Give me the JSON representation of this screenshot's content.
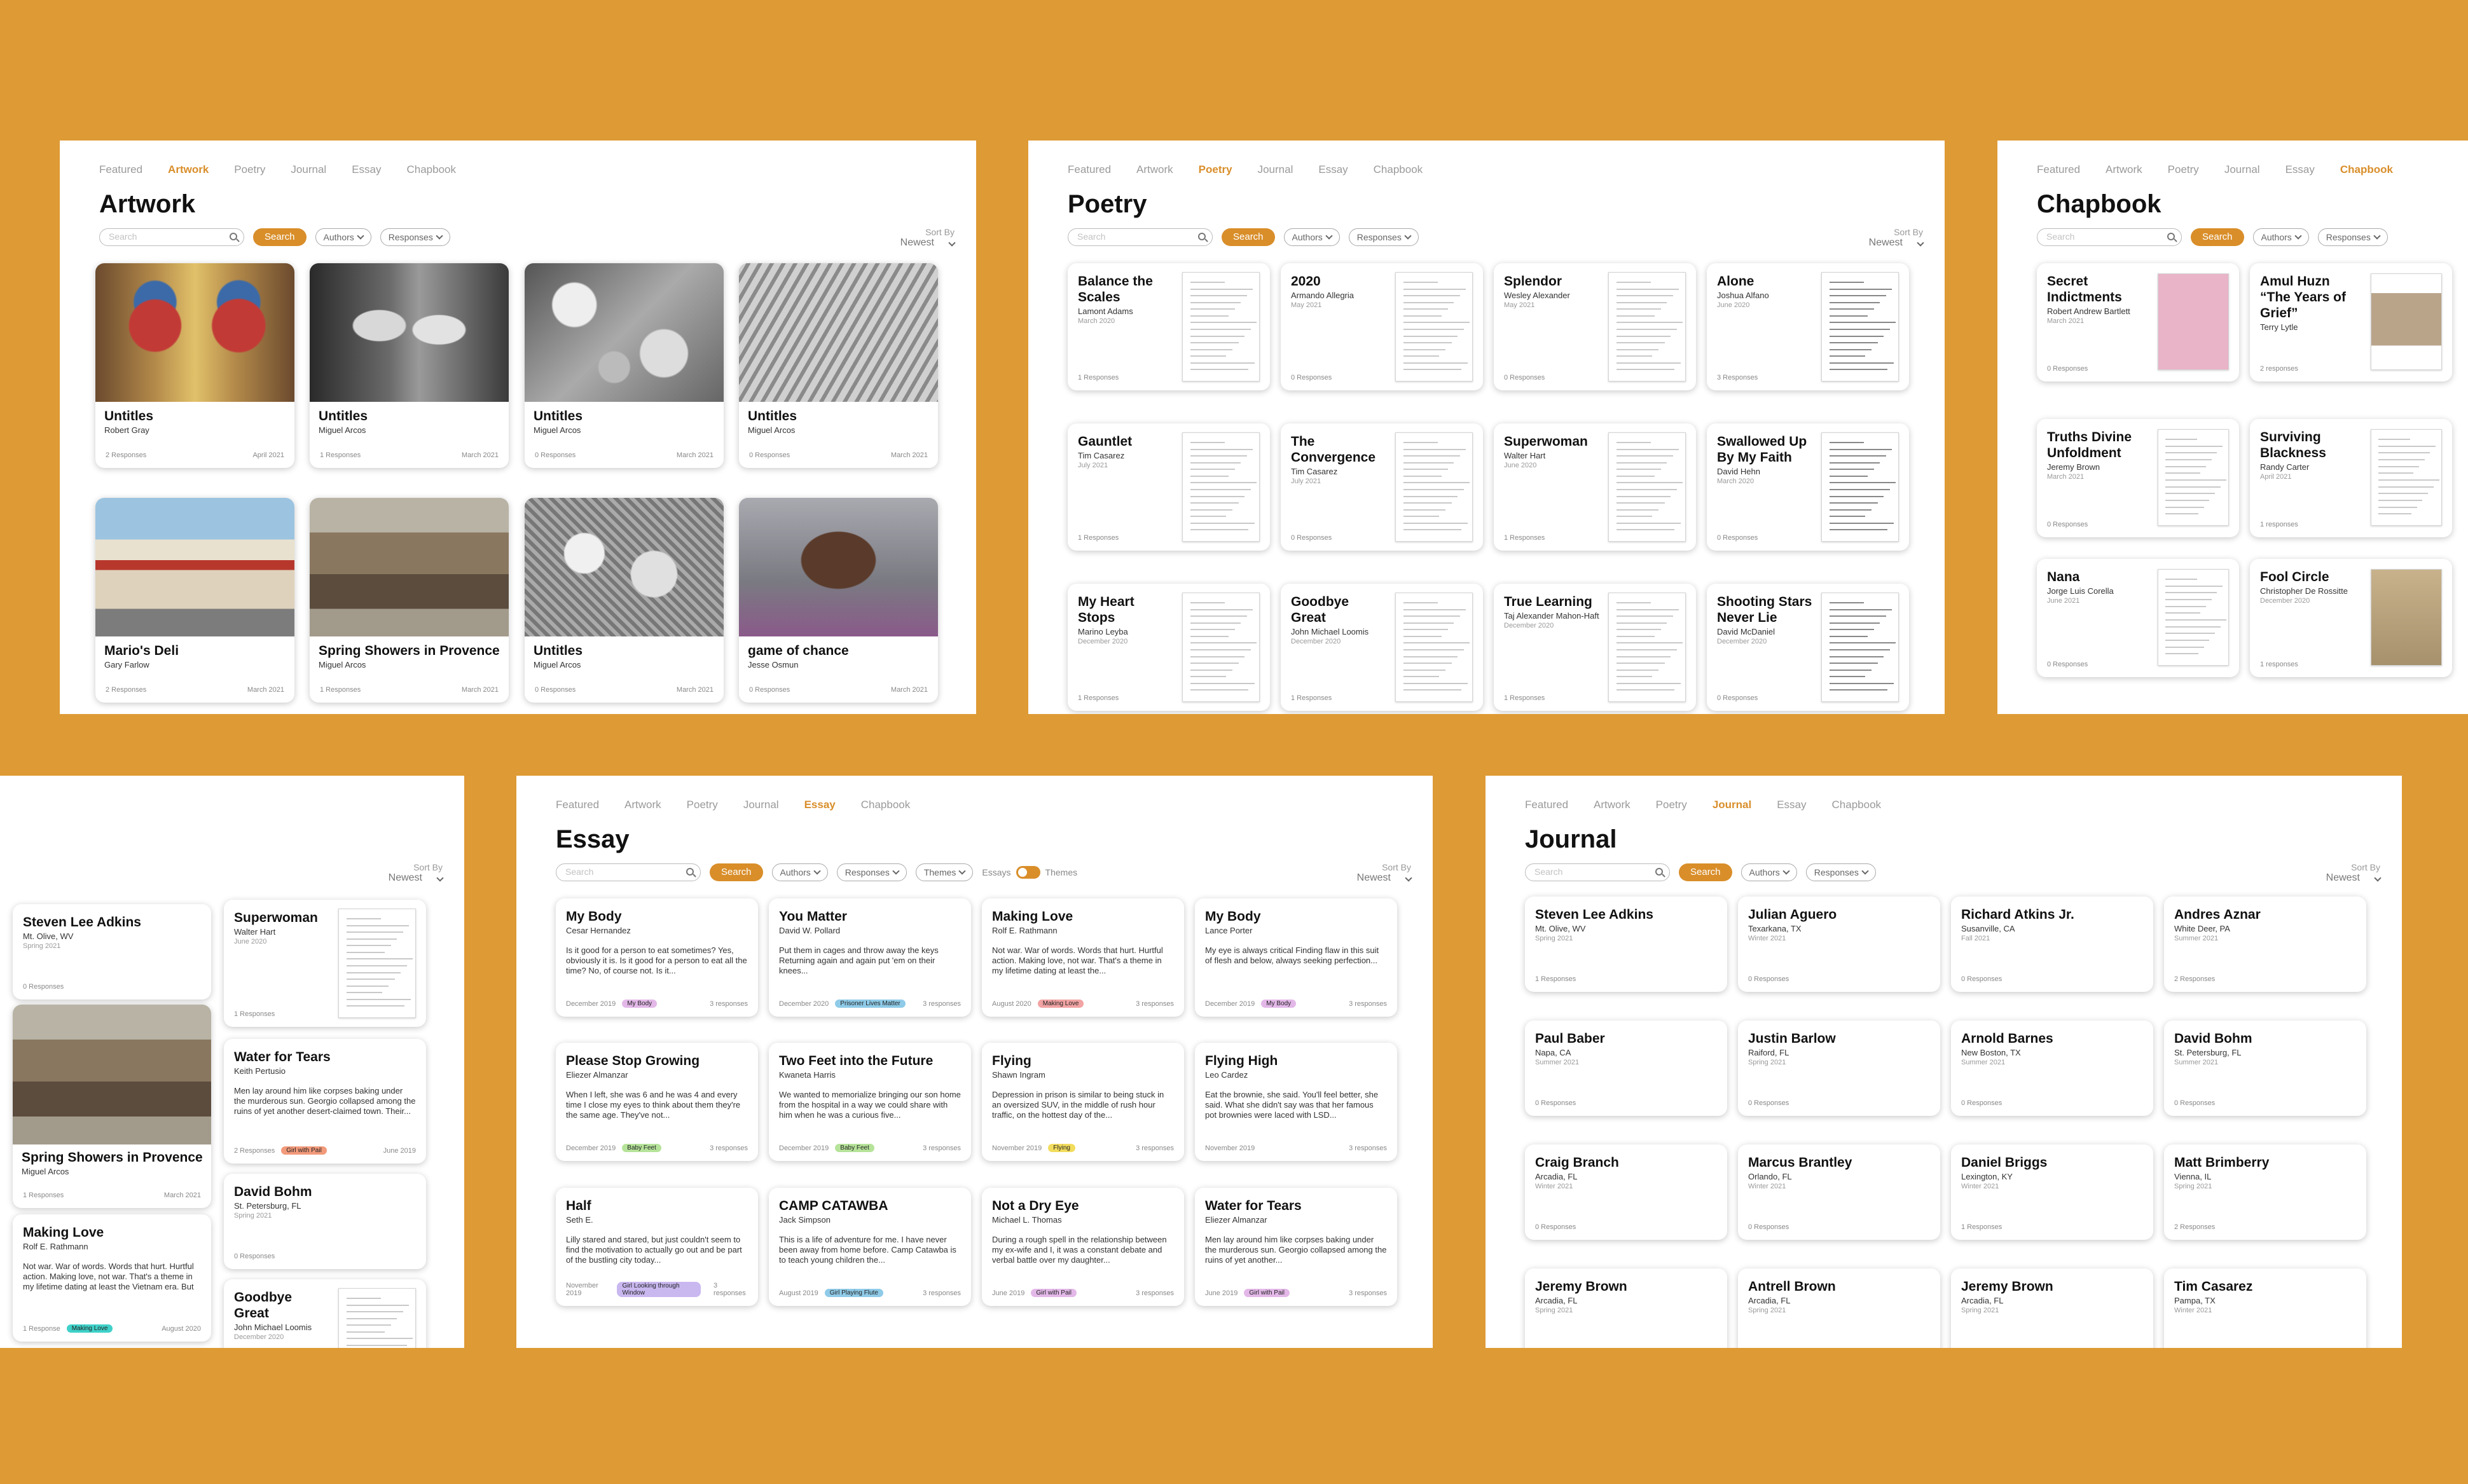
{
  "nav": [
    "Featured",
    "Artwork",
    "Poetry",
    "Journal",
    "Essay",
    "Chapbook"
  ],
  "ui": {
    "search_placeholder": "Search",
    "search_btn": "Search",
    "authors": "Authors",
    "responses": "Responses",
    "themes": "Themes",
    "sort_label": "Sort By",
    "sort_value": "Newest",
    "toggle_left": "Essays",
    "toggle_right": "Themes"
  },
  "artwork": {
    "title": "Artwork",
    "cards": [
      {
        "title": "Untitles",
        "author": "Robert Gray",
        "responses": "2 Responses",
        "date": "April 2021",
        "img": "baboons"
      },
      {
        "title": "Untitles",
        "author": "Miguel Arcos",
        "responses": "1 Responses",
        "date": "March 2021",
        "img": "portrait"
      },
      {
        "title": "Untitles",
        "author": "Miguel Arcos",
        "responses": "0 Responses",
        "date": "March 2021",
        "img": "faces"
      },
      {
        "title": "Untitles",
        "author": "Miguel Arcos",
        "responses": "0 Responses",
        "date": "March 2021",
        "img": "tiger"
      },
      {
        "title": "Mario's Deli",
        "author": "Gary Farlow",
        "responses": "2 Responses",
        "date": "March 2021",
        "img": "deli"
      },
      {
        "title": "Spring Showers in Provence",
        "author": "Miguel Arcos",
        "responses": "1 Responses",
        "date": "March 2021",
        "img": "street"
      },
      {
        "title": "Untitles",
        "author": "Miguel Arcos",
        "responses": "0 Responses",
        "date": "March 2021",
        "img": "animals"
      },
      {
        "title": "game of chance",
        "author": "Jesse Osmun",
        "responses": "0 Responses",
        "date": "March 2021",
        "img": "gamer"
      }
    ]
  },
  "poetry": {
    "title": "Poetry",
    "cards": [
      {
        "title": "Balance the Scales",
        "author": "Lamont Adams",
        "date": "March 2020",
        "responses": "1 Responses"
      },
      {
        "title": "2020",
        "author": "Armando Allegria",
        "date": "May 2021",
        "responses": "0 Responses"
      },
      {
        "title": "Splendor",
        "author": "Wesley Alexander",
        "date": "May 2021",
        "responses": "0 Responses"
      },
      {
        "title": "Alone",
        "author": "Joshua Alfano",
        "date": "June 2020",
        "responses": "3 Responses"
      },
      {
        "title": "Gauntlet",
        "author": "Tim Casarez",
        "date": "July 2021",
        "responses": "1 Responses"
      },
      {
        "title": "The Convergence",
        "author": "Tim Casarez",
        "date": "July 2021",
        "responses": "0 Responses"
      },
      {
        "title": "Superwoman",
        "author": "Walter Hart",
        "date": "June 2020",
        "responses": "1 Responses"
      },
      {
        "title": "Swallowed Up By My Faith",
        "author": "David Hehn",
        "date": "March 2020",
        "responses": "0 Responses"
      },
      {
        "title": "My Heart Stops",
        "author": "Marino Leyba",
        "date": "December 2020",
        "responses": "1 Responses"
      },
      {
        "title": "Goodbye Great",
        "author": "John Michael Loomis",
        "date": "December 2020",
        "responses": "1 Responses"
      },
      {
        "title": "True Learning",
        "author": "Taj Alexander Mahon-Haft",
        "date": "December 2020",
        "responses": "1 Responses"
      },
      {
        "title": "Shooting Stars Never Lie",
        "author": "David McDaniel",
        "date": "December 2020",
        "responses": "0 Responses"
      }
    ]
  },
  "chapbook": {
    "title": "Chapbook",
    "cards": [
      {
        "title": "Secret Indictments",
        "author": "Robert Andrew Bartlett",
        "date": "March 2021",
        "responses": "0 Responses",
        "cover": "pink"
      },
      {
        "title": "Amul Huzn “The Years of Grief”",
        "author": "Terry Lytle",
        "date": "",
        "responses": "2 responses",
        "cover": "photo"
      },
      {
        "title": "Truths Divine Unfoldment",
        "author": "Jeremy Brown",
        "date": "March 2021",
        "responses": "0 Responses",
        "cover": "page"
      },
      {
        "title": "Surviving Blackness",
        "author": "Randy Carter",
        "date": "April 2021",
        "responses": "1 responses",
        "cover": "page"
      },
      {
        "title": "Nana",
        "author": "Jorge Luis Corella",
        "date": "June 2021",
        "responses": "0 Responses",
        "cover": "page"
      },
      {
        "title": "Fool Circle",
        "author": "Christopher De Rossitte",
        "date": "December 2020",
        "responses": "1 responses",
        "cover": "tan"
      }
    ]
  },
  "featured": {
    "sort": {
      "label": "Sort By",
      "value": "Newest"
    },
    "col1": [
      {
        "title": "Steven Lee Adkins",
        "sub": "Mt. Olive, WV",
        "date": "Spring 2021",
        "responses": "0 Responses"
      },
      {
        "title": "Spring Showers in Provence",
        "sub": "Miguel Arcos",
        "responses": "1 Responses",
        "date": "March 2021"
      },
      {
        "title": "Making Love",
        "sub": "Rolf E. Rathmann",
        "excerpt": "Not war. War of words. Words that hurt. Hurtful action. Making love, not war. That's a theme in my lifetime dating at least the Vietnam era. But with...",
        "responses": "1 Response",
        "tag": "Making Love",
        "date": "August 2020"
      }
    ],
    "col2": [
      {
        "title": "Superwoman",
        "sub": "Walter Hart",
        "date": "June 2020",
        "responses": "1 Responses"
      },
      {
        "title": "Water for Tears",
        "sub": "Keith Pertusio",
        "excerpt": "Men lay around him like corpses baking under the murderous sun. Georgio collapsed among the ruins of yet another desert-claimed town. Their...",
        "responses": "2 Responses",
        "tag": "Girl with Pail",
        "date": "June 2019"
      },
      {
        "title": "David Bohm",
        "sub": "St. Petersburg, FL",
        "date": "Spring 2021",
        "responses": "0 Responses"
      },
      {
        "title": "Goodbye Great",
        "sub": "John Michael Loomis",
        "date": "December 2020"
      }
    ]
  },
  "essay": {
    "title": "Essay",
    "cards": [
      {
        "title": "My Body",
        "author": "Cesar Hernandez",
        "excerpt": "Is it good for a person to eat sometimes? Yes, obviously it is. Is it good for a person to eat all the time? No, of course not. Is it...",
        "date": "December 2019",
        "tag": "My Body",
        "tagColor": "#E3B8E8",
        "responses": "3 responses"
      },
      {
        "title": "You Matter",
        "author": "David W. Pollard",
        "excerpt": "Put them in cages and throw away the keys Returning again and again put 'em on their knees...",
        "date": "December 2020",
        "tag": "Prisoner Lives Matter",
        "tagColor": "#8FCBE8",
        "responses": "3 responses"
      },
      {
        "title": "Making Love",
        "author": "Rolf E. Rathmann",
        "excerpt": "Not war. War of words. Words that hurt. Hurtful action. Making love, not war. That's a theme in my lifetime dating at least the...",
        "date": "August 2020",
        "tag": "Making Love",
        "tagColor": "#F2A3A3",
        "responses": "3 responses"
      },
      {
        "title": "My Body",
        "author": "Lance Porter",
        "excerpt": "My eye is always critical Finding flaw in this suit of flesh and below, always seeking perfection...",
        "date": "December 2019",
        "tag": "My Body",
        "tagColor": "#E3B8E8",
        "responses": "3 responses"
      },
      {
        "title": "Please Stop Growing",
        "author": "Eliezer Almanzar",
        "excerpt": "When I left, she was 6 and he was 4 and every time I close my eyes to think about them they're the same age. They've not...",
        "date": "December 2019",
        "tag": "Baby Feet",
        "tagColor": "#B6E39A",
        "responses": "3 responses"
      },
      {
        "title": "Two Feet into the Future",
        "author": "Kwaneta Harris",
        "excerpt": "We wanted to memorialize bringing our son home from the hospital in a way we could share with him when he was a curious five...",
        "date": "December 2019",
        "tag": "Baby Feet",
        "tagColor": "#B6E39A",
        "responses": "3 responses"
      },
      {
        "title": "Flying",
        "author": "Shawn Ingram",
        "excerpt": "Depression in prison is similar to being stuck in an oversized SUV, in the middle of rush hour traffic, on the hottest day of the...",
        "date": "November 2019",
        "tag": "Flying",
        "tagColor": "#F2DC5D",
        "responses": "3 responses"
      },
      {
        "title": "Flying High",
        "author": "Leo Cardez",
        "excerpt": "Eat the brownie, she said. You'll feel better, she said. What she didn't say was that her famous pot brownies were laced with LSD...",
        "date": "November 2019",
        "tag": "",
        "tagColor": "",
        "responses": "3 responses"
      },
      {
        "title": "Half",
        "author": "Seth E.",
        "excerpt": "Lilly stared and stared, but just couldn't seem to find the motivation to actually go out and be part of the bustling city today...",
        "date": "November 2019",
        "tag": "Girl Looking through Window",
        "tagColor": "#C9B8F0",
        "responses": "3 responses"
      },
      {
        "title": "CAMP CATAWBA",
        "author": "Jack Simpson",
        "excerpt": "This is a life of adventure for me. I have never been away from home before. Camp Catawba is to teach young children the...",
        "date": "August 2019",
        "tag": "Girl Playing Flute",
        "tagColor": "#8FCBE8",
        "responses": "3 responses"
      },
      {
        "title": "Not a Dry Eye",
        "author": "Michael L. Thomas",
        "excerpt": "During a rough spell in the relationship between my ex-wife and I, it was a constant debate and verbal battle over my daughter...",
        "date": "June 2019",
        "tag": "Girl with Pail",
        "tagColor": "#E3B8E8",
        "responses": "3 responses"
      },
      {
        "title": "Water for Tears",
        "author": "Eliezer Almanzar",
        "excerpt": "Men lay around him like corpses baking under the murderous sun. Georgio collapsed among the ruins of yet another...",
        "date": "June 2019",
        "tag": "Girl with Pail",
        "tagColor": "#E3B8E8",
        "responses": "3 responses"
      }
    ]
  },
  "journal": {
    "title": "Journal",
    "cards": [
      {
        "title": "Steven Lee Adkins",
        "sub": "Mt. Olive, WV",
        "season": "Spring 2021",
        "responses": "1 Responses"
      },
      {
        "title": "Julian Aguero",
        "sub": "Texarkana, TX",
        "season": "Winter 2021",
        "responses": "0 Responses"
      },
      {
        "title": "Richard Atkins Jr.",
        "sub": "Susanville, CA",
        "season": "Fall 2021",
        "responses": "0 Responses"
      },
      {
        "title": "Andres Aznar",
        "sub": "White Deer, PA",
        "season": "Summer 2021",
        "responses": "2 Responses"
      },
      {
        "title": "Paul Baber",
        "sub": "Napa, CA",
        "season": "Summer 2021",
        "responses": "0 Responses"
      },
      {
        "title": "Justin Barlow",
        "sub": "Raiford, FL",
        "season": "Spring 2021",
        "responses": "0 Responses"
      },
      {
        "title": "Arnold Barnes",
        "sub": "New Boston, TX",
        "season": "Summer 2021",
        "responses": "0 Responses"
      },
      {
        "title": "David Bohm",
        "sub": "St. Petersburg, FL",
        "season": "Summer 2021",
        "responses": "0 Responses"
      },
      {
        "title": "Craig Branch",
        "sub": "Arcadia, FL",
        "season": "Winter 2021",
        "responses": "0 Responses"
      },
      {
        "title": "Marcus Brantley",
        "sub": "Orlando, FL",
        "season": "Winter 2021",
        "responses": "0 Responses"
      },
      {
        "title": "Daniel Briggs",
        "sub": "Lexington, KY",
        "season": "Winter 2021",
        "responses": "1 Responses"
      },
      {
        "title": "Matt Brimberry",
        "sub": "Vienna, IL",
        "season": "Spring 2021",
        "responses": "2 Responses"
      },
      {
        "title": "Jeremy Brown",
        "sub": "Arcadia, FL",
        "season": "Spring 2021",
        "responses": "0 Responses"
      },
      {
        "title": "Antrell Brown",
        "sub": "Arcadia, FL",
        "season": "Spring 2021",
        "responses": "0 Responses"
      },
      {
        "title": "Jeremy Brown",
        "sub": "Arcadia, FL",
        "season": "Spring 2021",
        "responses": "0 Responses"
      },
      {
        "title": "Tim Casarez",
        "sub": "Pampa, TX",
        "season": "Winter 2021",
        "responses": "0 Responses"
      }
    ]
  }
}
